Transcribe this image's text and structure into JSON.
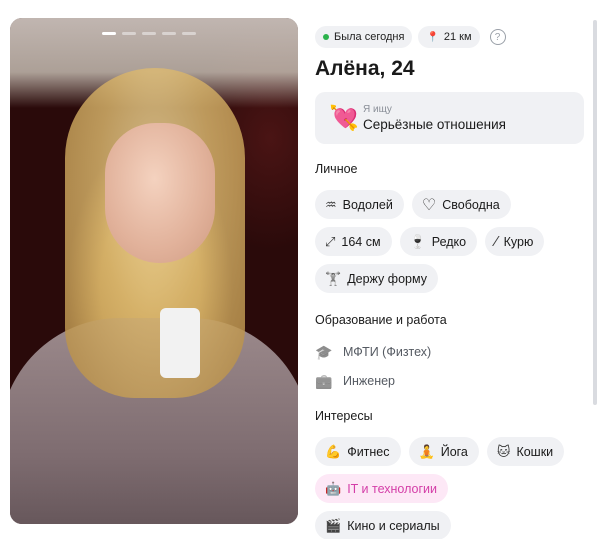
{
  "photo": {
    "slide_count": 5,
    "active_slide": 1
  },
  "status": {
    "online": "Была сегодня",
    "online_color": "#2bb24c",
    "distance": "21 км",
    "help_icon": "?"
  },
  "profile": {
    "name_age": "Алёна, 24"
  },
  "looking_for": {
    "icon": "💘",
    "label": "Я ищу",
    "value": "Серьёзные отношения"
  },
  "personal": {
    "title": "Личное",
    "items": [
      {
        "icon": "♒",
        "label": "Водолей"
      },
      {
        "icon": "♡",
        "label": "Свободна"
      },
      {
        "icon": "⤢",
        "label": "164 см"
      },
      {
        "icon": "🍷",
        "label": "Редко"
      },
      {
        "icon": "⁄",
        "label": "Курю"
      },
      {
        "icon": "🏋",
        "label": "Держу форму"
      }
    ]
  },
  "education": {
    "title": "Образование и работа",
    "items": [
      {
        "icon": "🎓",
        "label": "МФТИ (Физтех)"
      },
      {
        "icon": "💼",
        "label": "Инженер"
      }
    ]
  },
  "interests": {
    "title": "Интересы",
    "items": [
      {
        "icon": "💪",
        "label": "Фитнес",
        "highlight": false
      },
      {
        "icon": "🧘",
        "label": "Йога",
        "highlight": false
      },
      {
        "icon": "🐱",
        "label": "Кошки",
        "highlight": false
      },
      {
        "icon": "🤖",
        "label": "IT и технологии",
        "highlight": true
      },
      {
        "icon": "🎬",
        "label": "Кино и сериалы",
        "highlight": false
      }
    ],
    "highlight_color": "#d43ea8"
  }
}
